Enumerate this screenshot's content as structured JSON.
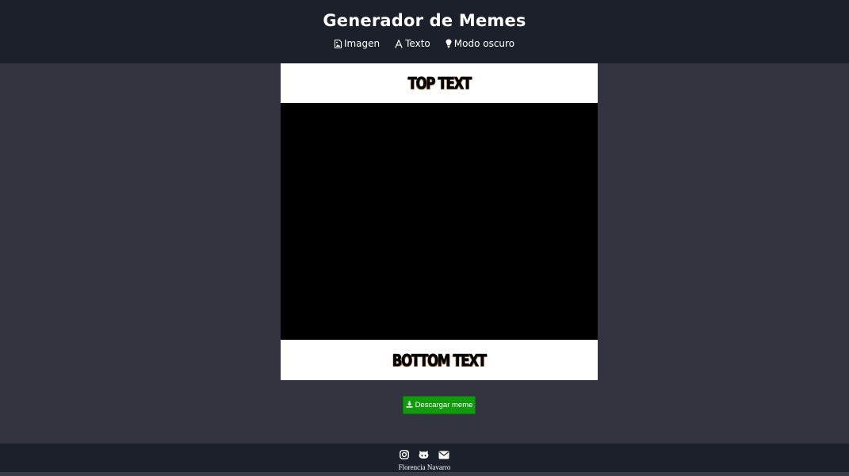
{
  "header": {
    "title": "Generador de Memes",
    "nav": [
      {
        "label": "Imagen",
        "icon": "image-file-icon"
      },
      {
        "label": "Texto",
        "icon": "font-icon"
      },
      {
        "label": "Modo oscuro",
        "icon": "lightbulb-icon"
      }
    ]
  },
  "meme": {
    "top_text": "TOP TEXT",
    "bottom_text": "BOTTOM TEXT",
    "image_background": "#000000",
    "text_background": "#ffffff"
  },
  "download": {
    "label": "Descargar meme",
    "icon": "download-icon",
    "color": "#119a0e"
  },
  "footer": {
    "social": [
      "instagram-icon",
      "github-icon",
      "envelope-icon"
    ],
    "author": "Florencia Navarro"
  },
  "colors": {
    "header_bg": "#1b202b",
    "page_bg": "#32353f"
  }
}
